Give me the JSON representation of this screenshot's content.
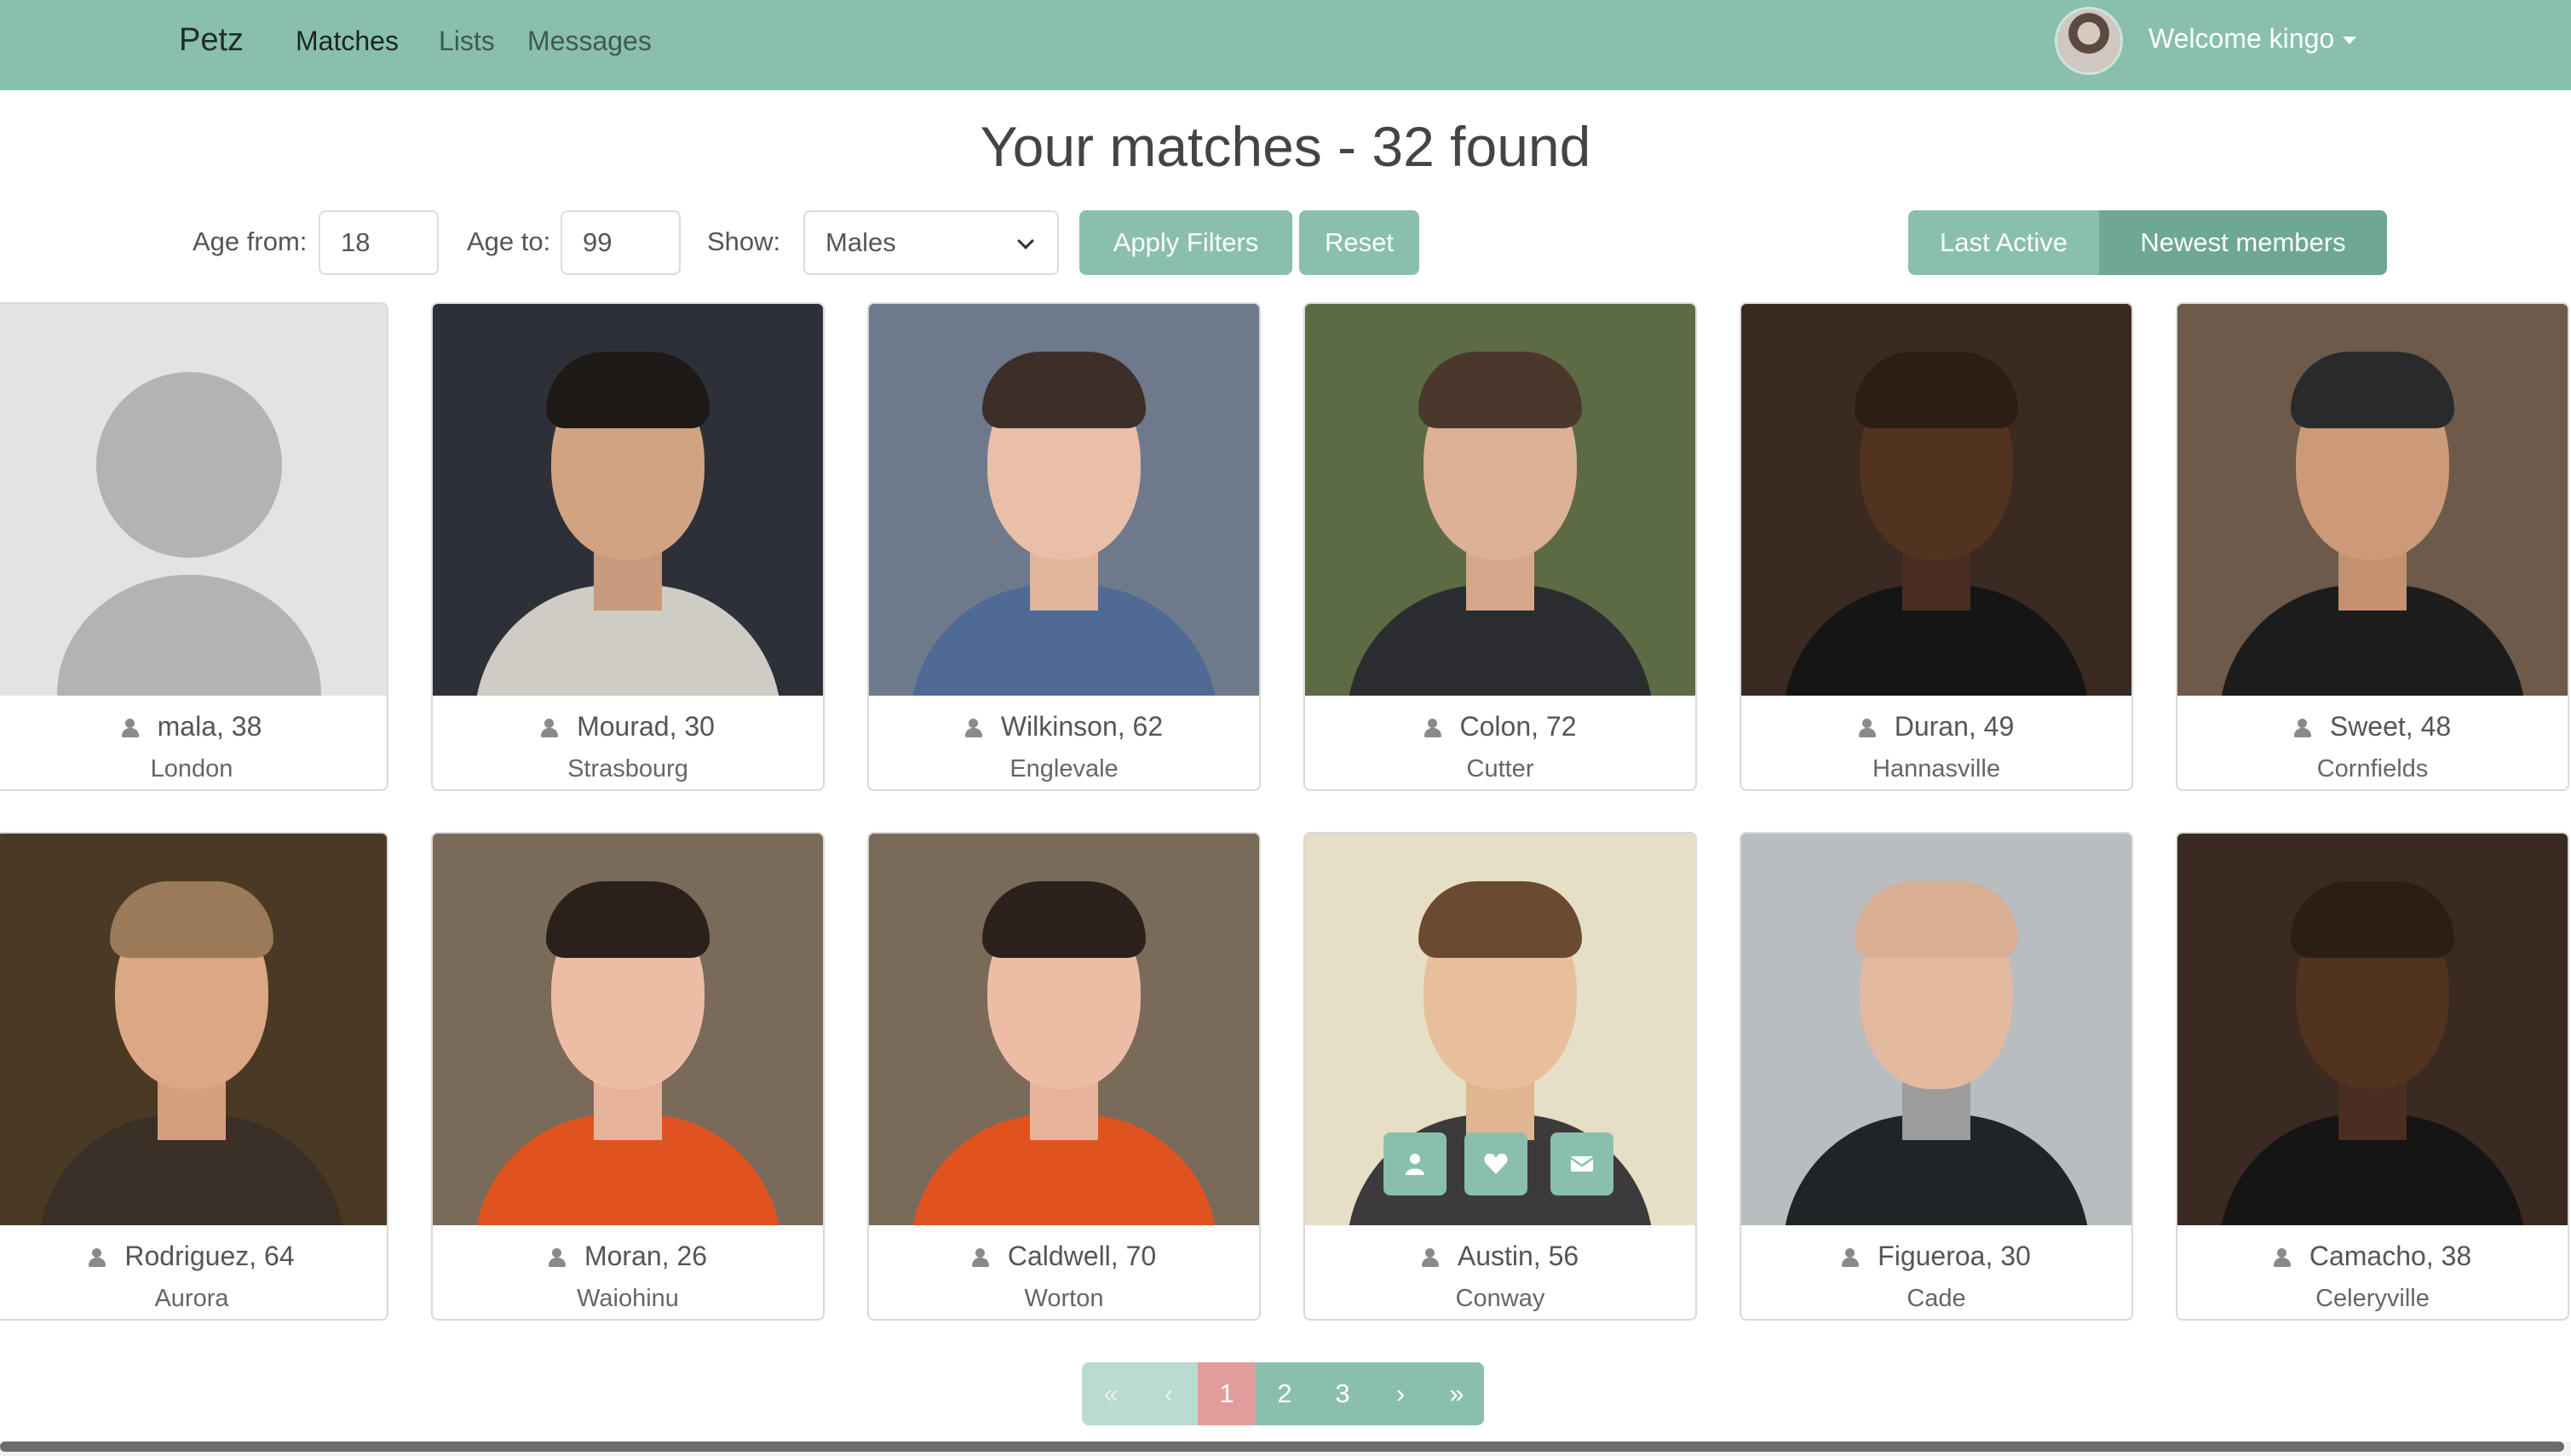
{
  "navbar": {
    "brand": "Petz",
    "links": [
      "Matches",
      "Lists",
      "Messages"
    ],
    "welcome": "Welcome kingo"
  },
  "heading": "Your matches - 32 found",
  "filters": {
    "age_from_label": "Age from:",
    "age_from_value": "18",
    "age_to_label": "Age to:",
    "age_to_value": "99",
    "show_label": "Show:",
    "show_value": "Males",
    "apply_label": "Apply Filters",
    "reset_label": "Reset",
    "sort_options": [
      "Last Active",
      "Newest members"
    ],
    "sort_selected": "Newest members"
  },
  "members": [
    {
      "name": "mala, 38",
      "city": "London",
      "photo": "placeholder"
    },
    {
      "name": "Mourad, 30",
      "city": "Strasbourg",
      "photo": "photo"
    },
    {
      "name": "Wilkinson, 62",
      "city": "Englevale",
      "photo": "photo"
    },
    {
      "name": "Colon, 72",
      "city": "Cutter",
      "photo": "photo"
    },
    {
      "name": "Duran, 49",
      "city": "Hannasville",
      "photo": "photo"
    },
    {
      "name": "Sweet, 48",
      "city": "Cornfields",
      "photo": "photo"
    },
    {
      "name": "Rodriguez, 64",
      "city": "Aurora",
      "photo": "photo"
    },
    {
      "name": "Moran, 26",
      "city": "Waiohinu",
      "photo": "photo"
    },
    {
      "name": "Caldwell, 70",
      "city": "Worton",
      "photo": "photo"
    },
    {
      "name": "Austin, 56",
      "city": "Conway",
      "photo": "photo",
      "hovered": true
    },
    {
      "name": "Figueroa, 30",
      "city": "Cade",
      "photo": "photo"
    },
    {
      "name": "Camacho, 38",
      "city": "Celeryville",
      "photo": "photo"
    }
  ],
  "card_actions": [
    "user-icon",
    "heart-icon",
    "envelope-icon"
  ],
  "pagination": {
    "first": "«",
    "prev": "‹",
    "pages": [
      "1",
      "2",
      "3"
    ],
    "current": "1",
    "next": "›",
    "last": "»"
  },
  "colors": {
    "accent": "#8abfae",
    "accent_dark": "#6fa795",
    "current_page": "#e39c9c"
  }
}
